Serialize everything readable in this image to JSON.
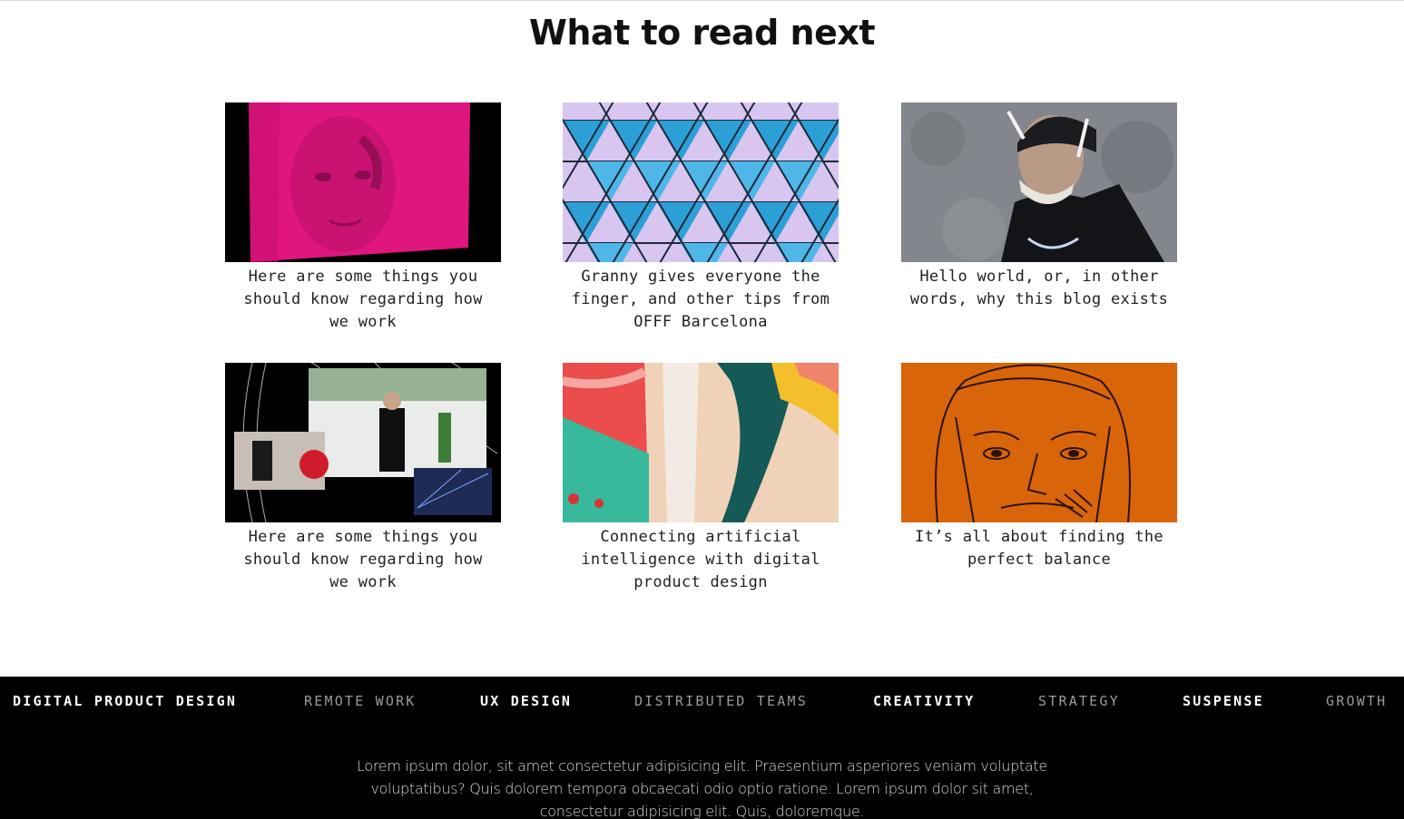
{
  "page": {
    "title": "What to read next"
  },
  "articles": [
    {
      "title": "Here are some things you should know regarding how we work",
      "image_icon": "magenta-portrait-image"
    },
    {
      "title": "Granny gives everyone the finger, and other tips from OFFF Barcelona",
      "image_icon": "geometric-triangles-image"
    },
    {
      "title": "Hello world, or, in other words, why this blog exists",
      "image_icon": "street-art-man-image"
    },
    {
      "title": "Here are some things you should know regarding how we work",
      "image_icon": "event-collage-image"
    },
    {
      "title": "Connecting artificial intelligence with digital product design",
      "image_icon": "abstract-painting-image"
    },
    {
      "title": "It’s all about finding the perfect balance",
      "image_icon": "orange-sketch-face-image"
    }
  ],
  "footer": {
    "tags": [
      {
        "label": "DIGITAL PRODUCT DESIGN",
        "style": "bright"
      },
      {
        "label": "REMOTE WORK",
        "style": "dim"
      },
      {
        "label": "UX DESIGN",
        "style": "bright"
      },
      {
        "label": "DISTRIBUTED TEAMS",
        "style": "dim"
      },
      {
        "label": "CREATIVITY",
        "style": "bright"
      },
      {
        "label": "STRATEGY",
        "style": "dim"
      },
      {
        "label": "SUSPENSE",
        "style": "bright"
      },
      {
        "label": "GROWTH",
        "style": "dim"
      }
    ],
    "text": "Lorem ipsum dolor, sit amet consectetur adipisicing elit. Praesentium asperiores veniam voluptate voluptatibus? Quis dolorem tempora obcaecati odio optio ratione. Lorem ipsum dolor sit amet, consectetur adipisicing elit. Quis, doloremque."
  },
  "colors": {
    "background": "#ffffff",
    "footer_bg": "#000000",
    "tag_bright": "#ffffff",
    "tag_dim": "#9a9a9a",
    "magenta": "#e0157f",
    "orange": "#d9650b"
  }
}
